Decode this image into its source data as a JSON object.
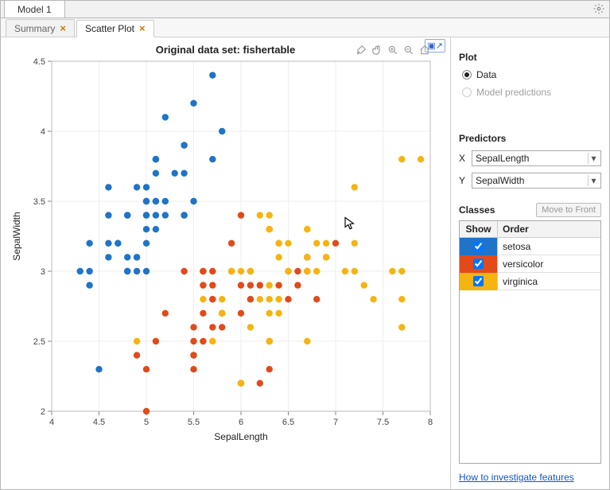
{
  "top_tab": "Model 1",
  "inner_tabs": {
    "summary": "Summary",
    "scatter": "Scatter Plot"
  },
  "chart": {
    "title": "Original data set: fishertable",
    "xlabel": "SepalLength",
    "ylabel": "SepalWidth"
  },
  "side": {
    "plot_title": "Plot",
    "radio_data": "Data",
    "radio_pred": "Model predictions",
    "predictors_title": "Predictors",
    "x_label": "X",
    "y_label": "Y",
    "x_value": "SepalLength",
    "y_value": "SepalWidth",
    "classes_title": "Classes",
    "move_btn": "Move to Front",
    "hdr_show": "Show",
    "hdr_order": "Order",
    "classes": [
      {
        "name": "setosa",
        "color": "#1f73c9"
      },
      {
        "name": "versicolor",
        "color": "#e24a1a"
      },
      {
        "name": "virginica",
        "color": "#f5b40f"
      }
    ],
    "help_link": "How to investigate features"
  },
  "chart_data": {
    "type": "scatter",
    "title": "Original data set: fishertable",
    "xlabel": "SepalLength",
    "ylabel": "SepalWidth",
    "xlim": [
      4,
      8
    ],
    "ylim": [
      2,
      4.5
    ],
    "xticks": [
      4,
      4.5,
      5,
      5.5,
      6,
      6.5,
      7,
      7.5,
      8
    ],
    "yticks": [
      2,
      2.5,
      3,
      3.5,
      4,
      4.5
    ],
    "series": [
      {
        "name": "setosa",
        "color": "#1f73c9",
        "points": [
          [
            5.1,
            3.5
          ],
          [
            4.9,
            3.0
          ],
          [
            4.7,
            3.2
          ],
          [
            4.6,
            3.1
          ],
          [
            5.0,
            3.6
          ],
          [
            5.4,
            3.9
          ],
          [
            4.6,
            3.4
          ],
          [
            5.0,
            3.4
          ],
          [
            4.4,
            2.9
          ],
          [
            4.9,
            3.1
          ],
          [
            5.4,
            3.7
          ],
          [
            4.8,
            3.4
          ],
          [
            4.8,
            3.0
          ],
          [
            4.3,
            3.0
          ],
          [
            5.8,
            4.0
          ],
          [
            5.7,
            4.4
          ],
          [
            5.4,
            3.9
          ],
          [
            5.1,
            3.5
          ],
          [
            5.7,
            3.8
          ],
          [
            5.1,
            3.8
          ],
          [
            5.4,
            3.4
          ],
          [
            5.1,
            3.7
          ],
          [
            4.6,
            3.6
          ],
          [
            5.1,
            3.3
          ],
          [
            4.8,
            3.4
          ],
          [
            5.0,
            3.0
          ],
          [
            5.0,
            3.4
          ],
          [
            5.2,
            3.5
          ],
          [
            5.2,
            3.4
          ],
          [
            4.7,
            3.2
          ],
          [
            4.8,
            3.1
          ],
          [
            5.4,
            3.4
          ],
          [
            5.2,
            4.1
          ],
          [
            5.5,
            4.2
          ],
          [
            4.9,
            3.1
          ],
          [
            5.0,
            3.2
          ],
          [
            5.5,
            3.5
          ],
          [
            4.9,
            3.6
          ],
          [
            4.4,
            3.0
          ],
          [
            5.1,
            3.4
          ],
          [
            5.0,
            3.5
          ],
          [
            4.5,
            2.3
          ],
          [
            4.4,
            3.2
          ],
          [
            5.0,
            3.5
          ],
          [
            5.1,
            3.8
          ],
          [
            4.8,
            3.0
          ],
          [
            5.1,
            3.8
          ],
          [
            4.6,
            3.2
          ],
          [
            5.3,
            3.7
          ],
          [
            5.0,
            3.3
          ]
        ]
      },
      {
        "name": "versicolor",
        "color": "#e24a1a",
        "points": [
          [
            7.0,
            3.2
          ],
          [
            6.4,
            3.2
          ],
          [
            6.9,
            3.1
          ],
          [
            5.5,
            2.3
          ],
          [
            6.5,
            2.8
          ],
          [
            5.7,
            2.8
          ],
          [
            6.3,
            3.3
          ],
          [
            4.9,
            2.4
          ],
          [
            6.6,
            2.9
          ],
          [
            5.2,
            2.7
          ],
          [
            5.0,
            2.0
          ],
          [
            5.9,
            3.0
          ],
          [
            6.0,
            2.2
          ],
          [
            6.1,
            2.9
          ],
          [
            5.6,
            2.9
          ],
          [
            6.7,
            3.1
          ],
          [
            5.6,
            3.0
          ],
          [
            5.8,
            2.7
          ],
          [
            6.2,
            2.2
          ],
          [
            5.6,
            2.5
          ],
          [
            5.9,
            3.2
          ],
          [
            6.1,
            2.8
          ],
          [
            6.3,
            2.5
          ],
          [
            6.1,
            2.8
          ],
          [
            6.4,
            2.9
          ],
          [
            6.6,
            3.0
          ],
          [
            6.8,
            2.8
          ],
          [
            6.7,
            3.0
          ],
          [
            6.0,
            2.9
          ],
          [
            5.7,
            2.6
          ],
          [
            5.5,
            2.4
          ],
          [
            5.5,
            2.4
          ],
          [
            5.8,
            2.7
          ],
          [
            6.0,
            2.7
          ],
          [
            5.4,
            3.0
          ],
          [
            6.0,
            3.4
          ],
          [
            6.7,
            3.1
          ],
          [
            6.3,
            2.3
          ],
          [
            5.6,
            3.0
          ],
          [
            5.5,
            2.5
          ],
          [
            5.5,
            2.6
          ],
          [
            6.1,
            3.0
          ],
          [
            5.8,
            2.6
          ],
          [
            5.0,
            2.3
          ],
          [
            5.6,
            2.7
          ],
          [
            5.7,
            3.0
          ],
          [
            5.7,
            2.9
          ],
          [
            6.2,
            2.9
          ],
          [
            5.1,
            2.5
          ],
          [
            5.7,
            2.8
          ]
        ]
      },
      {
        "name": "virginica",
        "color": "#f5b40f",
        "points": [
          [
            6.3,
            3.3
          ],
          [
            5.8,
            2.7
          ],
          [
            7.1,
            3.0
          ],
          [
            6.3,
            2.9
          ],
          [
            6.5,
            3.0
          ],
          [
            7.6,
            3.0
          ],
          [
            4.9,
            2.5
          ],
          [
            7.3,
            2.9
          ],
          [
            6.7,
            2.5
          ],
          [
            7.2,
            3.6
          ],
          [
            6.5,
            3.2
          ],
          [
            6.4,
            2.7
          ],
          [
            6.8,
            3.0
          ],
          [
            5.7,
            2.5
          ],
          [
            5.8,
            2.8
          ],
          [
            6.4,
            3.2
          ],
          [
            6.5,
            3.0
          ],
          [
            7.7,
            3.8
          ],
          [
            7.7,
            2.6
          ],
          [
            6.0,
            2.2
          ],
          [
            6.9,
            3.2
          ],
          [
            5.6,
            2.8
          ],
          [
            7.7,
            2.8
          ],
          [
            6.3,
            2.7
          ],
          [
            6.7,
            3.3
          ],
          [
            7.2,
            3.2
          ],
          [
            6.2,
            2.8
          ],
          [
            6.1,
            3.0
          ],
          [
            6.4,
            2.8
          ],
          [
            7.2,
            3.0
          ],
          [
            7.4,
            2.8
          ],
          [
            7.9,
            3.8
          ],
          [
            6.4,
            2.8
          ],
          [
            6.3,
            2.8
          ],
          [
            6.1,
            2.6
          ],
          [
            7.7,
            3.0
          ],
          [
            6.3,
            3.4
          ],
          [
            6.4,
            3.1
          ],
          [
            6.0,
            3.0
          ],
          [
            6.9,
            3.1
          ],
          [
            6.7,
            3.1
          ],
          [
            6.9,
            3.1
          ],
          [
            5.8,
            2.7
          ],
          [
            6.8,
            3.2
          ],
          [
            6.7,
            3.3
          ],
          [
            6.7,
            3.0
          ],
          [
            6.3,
            2.5
          ],
          [
            6.5,
            3.0
          ],
          [
            6.2,
            3.4
          ],
          [
            5.9,
            3.0
          ]
        ]
      }
    ]
  }
}
